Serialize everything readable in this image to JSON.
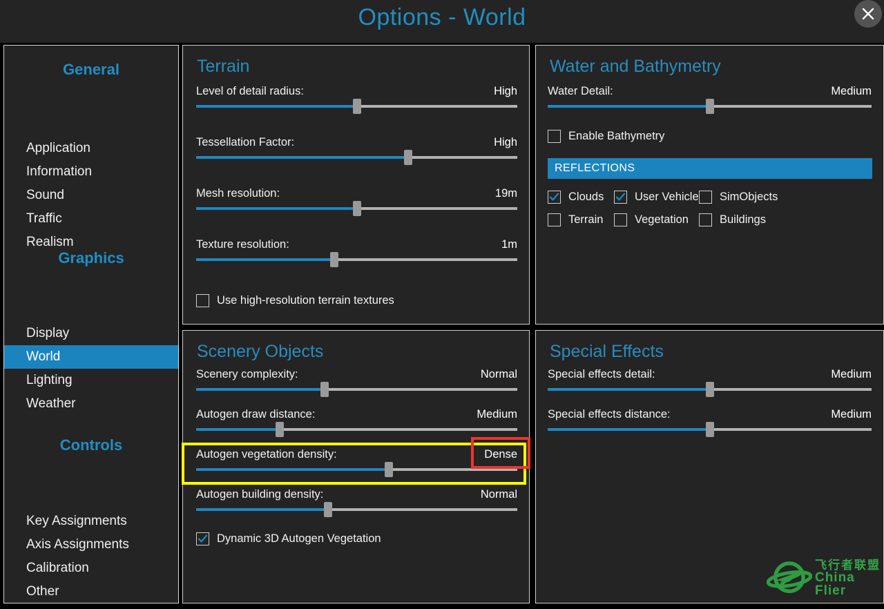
{
  "window": {
    "title": "Options - World",
    "close_icon": "close-icon"
  },
  "sidebar": {
    "groups": [
      {
        "heading": "General",
        "items": [
          {
            "label": "Application",
            "selected": false
          },
          {
            "label": "Information",
            "selected": false
          },
          {
            "label": "Sound",
            "selected": false
          },
          {
            "label": "Traffic",
            "selected": false
          },
          {
            "label": "Realism",
            "selected": false
          }
        ]
      },
      {
        "heading": "Graphics",
        "items": [
          {
            "label": "Display",
            "selected": false
          },
          {
            "label": "World",
            "selected": true
          },
          {
            "label": "Lighting",
            "selected": false
          },
          {
            "label": "Weather",
            "selected": false
          }
        ]
      },
      {
        "heading": "Controls",
        "items": [
          {
            "label": "Key Assignments",
            "selected": false
          },
          {
            "label": "Axis Assignments",
            "selected": false
          },
          {
            "label": "Calibration",
            "selected": false
          },
          {
            "label": "Other",
            "selected": false
          }
        ]
      }
    ]
  },
  "panels": {
    "terrain": {
      "title": "Terrain",
      "sliders": [
        {
          "label": "Level of detail radius:",
          "value": "High",
          "percent": 50
        },
        {
          "label": "Tessellation Factor:",
          "value": "High",
          "percent": 66
        },
        {
          "label": "Mesh resolution:",
          "value": "19m",
          "percent": 50
        },
        {
          "label": "Texture resolution:",
          "value": "1m",
          "percent": 43
        }
      ],
      "checkboxes": [
        {
          "label": "Use high-resolution terrain textures",
          "checked": false
        }
      ]
    },
    "water": {
      "title": "Water and Bathymetry",
      "sliders": [
        {
          "label": "Water Detail:",
          "value": "Medium",
          "percent": 50
        }
      ],
      "checkboxes": [
        {
          "label": "Enable Bathymetry",
          "checked": false
        }
      ],
      "reflections": {
        "banner": "REFLECTIONS",
        "items": [
          {
            "label": "Clouds",
            "checked": true
          },
          {
            "label": "User Vehicle",
            "checked": true
          },
          {
            "label": "SimObjects",
            "checked": false
          },
          {
            "label": "Terrain",
            "checked": false
          },
          {
            "label": "Vegetation",
            "checked": false
          },
          {
            "label": "Buildings",
            "checked": false
          }
        ]
      }
    },
    "scenery": {
      "title": "Scenery Objects",
      "sliders": [
        {
          "label": "Scenery complexity:",
          "value": "Normal",
          "percent": 40
        },
        {
          "label": "Autogen draw distance:",
          "value": "Medium",
          "percent": 26
        },
        {
          "label": "Autogen vegetation density:",
          "value": "Dense",
          "percent": 60
        },
        {
          "label": "Autogen building density:",
          "value": "Normal",
          "percent": 41
        }
      ],
      "checkboxes": [
        {
          "label": "Dynamic 3D Autogen Vegetation",
          "checked": true
        }
      ]
    },
    "effects": {
      "title": "Special Effects",
      "sliders": [
        {
          "label": "Special effects detail:",
          "value": "Medium",
          "percent": 50
        },
        {
          "label": "Special effects distance:",
          "value": "Medium",
          "percent": 50
        }
      ]
    }
  },
  "annotations": {
    "yellow_box_target": "Autogen vegetation density:",
    "red_box_target": "Dense"
  },
  "watermark": {
    "chinese": "飞行者联盟",
    "english": "China Flier",
    "icon": "plane-orbit-logo-icon"
  },
  "colors": {
    "accent_blue": "#1b84bf",
    "title_blue": "#1f8fc4",
    "panel_bg": "#242424",
    "highlight_yellow": "#ffff00",
    "highlight_red": "#ef3333",
    "watermark_green": "#34a54a"
  }
}
